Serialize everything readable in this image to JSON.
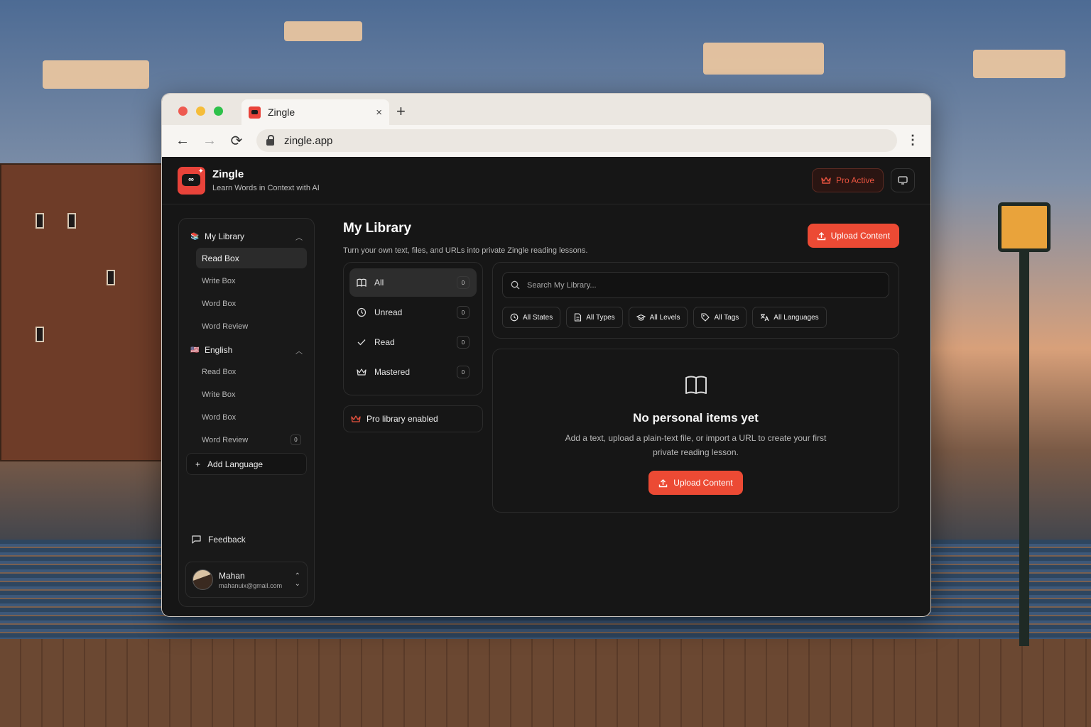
{
  "browser": {
    "tab_title": "Zingle",
    "tab_close": "×",
    "new_tab": "+",
    "url": "zingle.app",
    "back": "←",
    "forward": "→",
    "reload": "⟳",
    "menu": "⋮",
    "colors": {
      "close": "#ee5a50",
      "minimize": "#f5bd3a",
      "maximize": "#2ec14a"
    }
  },
  "app": {
    "brand": "Zingle",
    "tagline": "Learn Words in Context with AI",
    "pro_label": "Pro Active",
    "accent": "#ec4a34"
  },
  "sidebar": {
    "library_group": "My Library",
    "library_items": [
      {
        "label": "Read Box"
      },
      {
        "label": "Write Box"
      },
      {
        "label": "Word Box"
      },
      {
        "label": "Word Review"
      }
    ],
    "language_group": "English",
    "language_items": [
      {
        "label": "Read Box"
      },
      {
        "label": "Write Box"
      },
      {
        "label": "Word Box"
      },
      {
        "label": "Word Review",
        "count": "0"
      }
    ],
    "add_language": "Add Language",
    "feedback": "Feedback",
    "user": {
      "name": "Mahan",
      "email": "mahanuix@gmail.com"
    }
  },
  "main": {
    "title": "My Library",
    "subtitle": "Turn your own text, files, and URLs into private Zingle reading lessons.",
    "upload_label": "Upload Content",
    "filters": [
      {
        "label": "All",
        "count": "0",
        "icon": "book-icon"
      },
      {
        "label": "Unread",
        "count": "0",
        "icon": "clock-icon"
      },
      {
        "label": "Read",
        "count": "0",
        "icon": "check-icon"
      },
      {
        "label": "Mastered",
        "count": "0",
        "icon": "crown-icon"
      }
    ],
    "pro_library": "Pro library enabled",
    "search_placeholder": "Search My Library...",
    "chips": [
      {
        "label": "All States",
        "icon": "clock-icon"
      },
      {
        "label": "All Types",
        "icon": "file-icon"
      },
      {
        "label": "All Levels",
        "icon": "graduation-cap-icon"
      },
      {
        "label": "All Tags",
        "icon": "tag-icon"
      },
      {
        "label": "All Languages",
        "icon": "translate-icon"
      }
    ],
    "empty": {
      "title": "No personal items yet",
      "description": "Add a text, upload a plain-text file, or import a URL to create your first private reading lesson.",
      "button": "Upload Content"
    }
  }
}
